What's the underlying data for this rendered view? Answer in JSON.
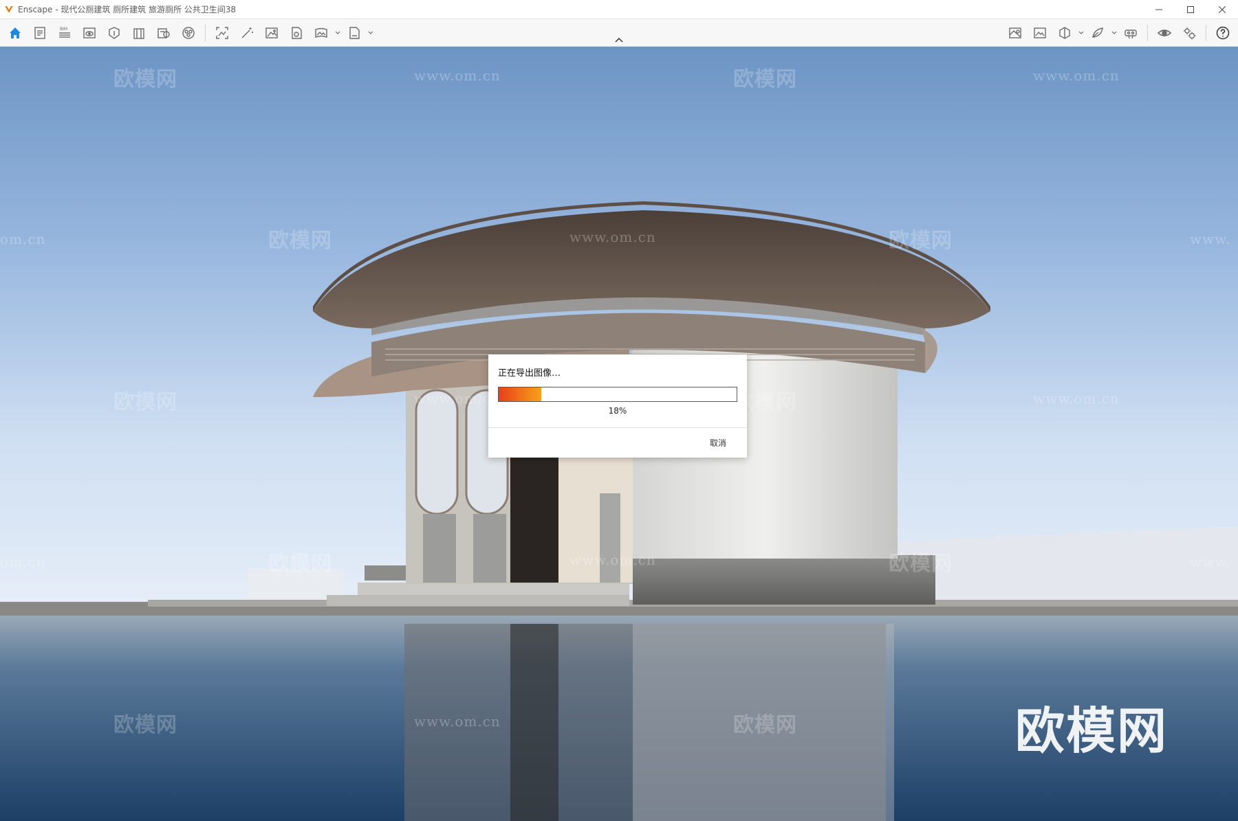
{
  "window": {
    "app_name": "Enscape",
    "title": "Enscape - 现代公厕建筑 厕所建筑 旅游厕所 公共卫生间38",
    "controls": [
      "minimize-icon",
      "maximize-icon",
      "close-icon"
    ]
  },
  "toolbar": {
    "left_items": [
      {
        "icon": "home-icon",
        "active": true
      },
      {
        "icon": "document-settings-icon"
      },
      {
        "icon": "bim-icon",
        "text": "BIM"
      },
      {
        "icon": "view-eye-icon"
      },
      {
        "icon": "asset-library-icon"
      },
      {
        "icon": "building-icon"
      },
      {
        "icon": "material-editor-icon"
      },
      {
        "icon": "atmosphere-icon"
      },
      {
        "icon": "screenshot-icon"
      },
      {
        "icon": "magic-wand-icon"
      },
      {
        "icon": "image-export-icon"
      },
      {
        "icon": "video-export-icon"
      },
      {
        "icon": "panorama-icon",
        "dropdown": true
      },
      {
        "icon": "batch-export-icon",
        "dropdown": true
      }
    ],
    "right_items": [
      {
        "icon": "map-icon"
      },
      {
        "icon": "gallery-icon"
      },
      {
        "icon": "cube-view-icon",
        "dropdown": true
      },
      {
        "icon": "feedback-icon",
        "dropdown": true
      },
      {
        "icon": "vr-headset-icon"
      },
      {
        "icon": "visual-settings-eye-icon"
      },
      {
        "icon": "general-settings-icon"
      },
      {
        "icon": "help-icon"
      }
    ]
  },
  "watermarks": {
    "logo_text": "欧模网",
    "url_text": "www.om.cn",
    "partial_url_text": "om.cn",
    "partial_url_right": "www.",
    "brand_text": "欧模网"
  },
  "dialog": {
    "title": "正在导出图像…",
    "progress": 0.18,
    "progress_label": "18%",
    "cancel_label": "取消"
  },
  "colors": {
    "accent": "#1e88e5",
    "progress_start": "#e8401a",
    "progress_end": "#f6a21a"
  }
}
